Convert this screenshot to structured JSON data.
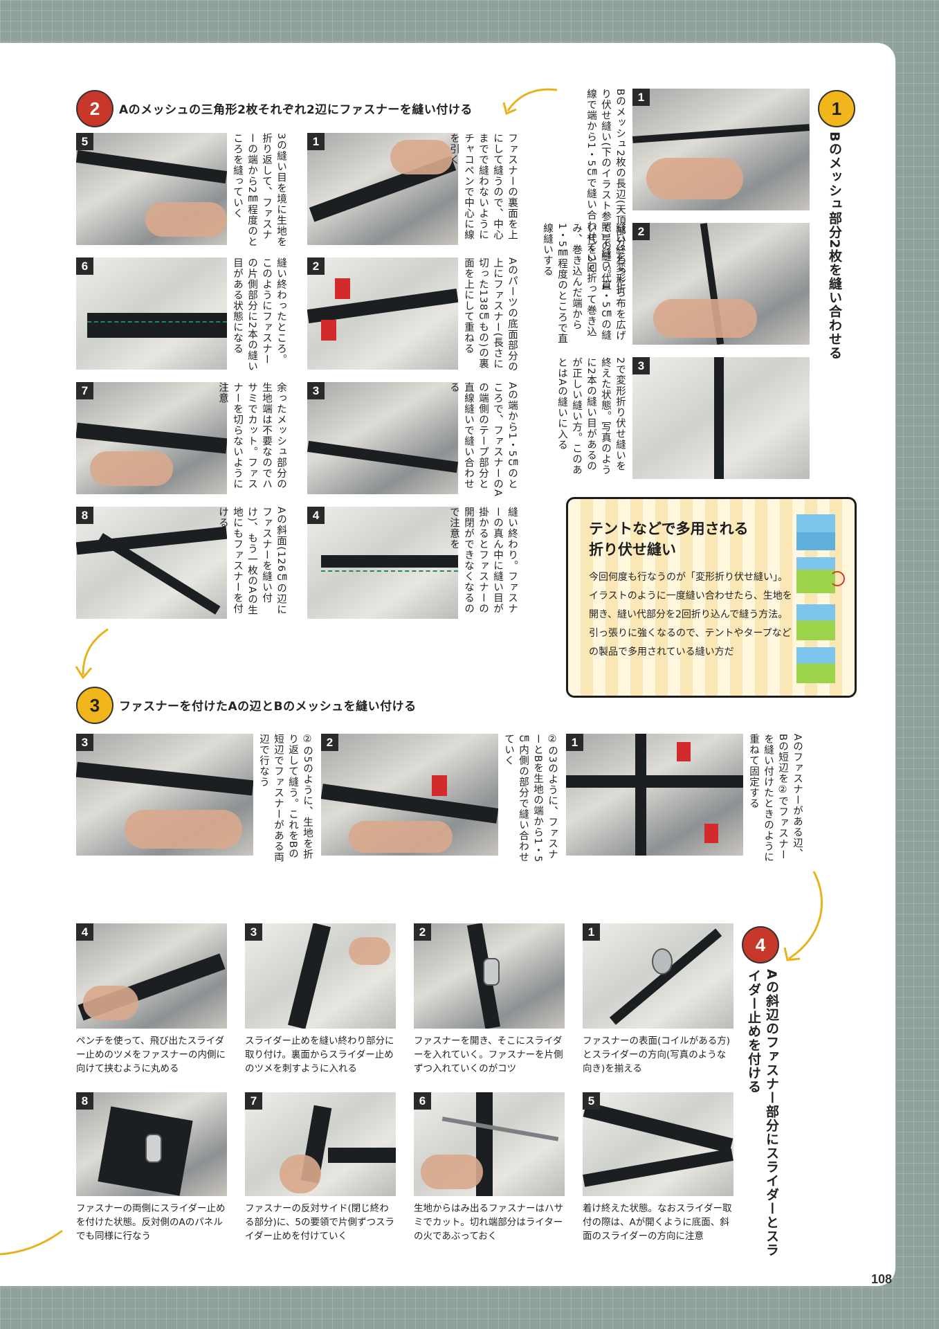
{
  "page_number": "108",
  "sections": {
    "s1": {
      "badge": "1",
      "title": "Bのメッシュ部分2枚を縫い合わせる",
      "steps": [
        {
          "num": "1",
          "text": "Bのメッシュ2枚の長辺(天頂部分)を変形折り伏せ縫い(下のイラスト参照)で縫う。直線で端から1・5㎝で縫い合わせていく"
        },
        {
          "num": "2",
          "text": "縫い終わったら布を広げて1の縫い代1・5㎝の縫い代を2回折って巻き込み、巻き込んだ端から1・5㎜程度のところで直線縫いする"
        },
        {
          "num": "3",
          "text": "2で変形折り伏せ縫いを終えた状態。写真のように2本の縫い目があるのが正しい縫い方。このあとはAの縫いに入る"
        }
      ]
    },
    "s2": {
      "badge": "2",
      "title": "Aのメッシュの三角形2枚それぞれ2辺にファスナーを縫い付ける",
      "steps": [
        {
          "num": "1",
          "text": "ファスナーの裏面を上にして縫うので、中心までで縫わないようにチャコペンで中心に線を引く"
        },
        {
          "num": "2",
          "text": "Aのパーツの底面部分の上にファスナー(長さに切った138㎝もの)の裏面を上にして重ねる"
        },
        {
          "num": "3",
          "text": "Aの端から1・5㎝のところで、ファスナーのAの端側のテープ部分と直線縫いで縫い合わせる"
        },
        {
          "num": "4",
          "text": "縫い終わり。ファスナーの真ん中に縫い目が掛かるとファスナーの開閉ができなくなるので注意を"
        },
        {
          "num": "5",
          "text": "3の縫い目を境に生地を折り返して、ファスナーの端から2㎜程度のところを縫っていく"
        },
        {
          "num": "6",
          "text": "縫い終わったところ。このようにファスナーの片側部分に2本の縫い目がある状態になる"
        },
        {
          "num": "7",
          "text": "余ったメッシュ部分の生地端は不要なのでハサミでカット。ファスナーを切らないように注意"
        },
        {
          "num": "8",
          "text": "Aの斜面(126㎝の辺にファスナーを縫い付け)、もう一枚のAの生地にもファスナーを付ける"
        }
      ]
    },
    "info_box": {
      "title_line1": "テントなどで多用される",
      "title_line2": "折り伏せ縫い",
      "text": "今回何度も行なうのが「変形折り伏せ縫い」。イラストのように一度縫い合わせたら、生地を開き、縫い代部分を2回折り込んで縫う方法。引っ張りに強くなるので、テントやタープなどの製品で多用されている縫い方だ"
    },
    "s3": {
      "badge": "3",
      "title": "ファスナーを付けたAの辺とBのメッシュを縫い付ける",
      "steps": [
        {
          "num": "1",
          "text": "Aのファスナーがある辺、Bの短辺を②でファスナーを縫い付けたときのように重ねて固定する"
        },
        {
          "num": "2",
          "text": "②の3のように、ファスナーとBを生地の端から1・5㎝内側の部分で縫い合わせていく"
        },
        {
          "num": "3",
          "text": "②の5のように、生地を折り返して縫う。これをBの短辺でファスナーがある両辺で行なう"
        }
      ]
    },
    "s4": {
      "badge": "4",
      "title": "Aの斜辺のファスナー部分にスライダーとスライダー止めを付ける",
      "steps": [
        {
          "num": "1",
          "text": "ファスナーの表面(コイルがある方)とスライダーの方向(写真のような向き)を揃える"
        },
        {
          "num": "2",
          "text": "ファスナーを開き、そこにスライダーを入れていく。ファスナーを片側ずつ入れていくのがコツ"
        },
        {
          "num": "3",
          "text": "スライダー止めを縫い終わり部分に取り付け。裏面からスライダー止めのツメを刺すように入れる"
        },
        {
          "num": "4",
          "text": "ペンチを使って、飛び出たスライダー止めのツメをファスナーの内側に向けて挟むように丸める"
        },
        {
          "num": "5",
          "text": "着け終えた状態。なおスライダー取付の際は、Aが開くように底面、斜面のスライダーの方向に注意"
        },
        {
          "num": "6",
          "text": "生地からはみ出るファスナーはハサミでカット。切れ端部分はライターの火であぶっておく"
        },
        {
          "num": "7",
          "text": "ファスナーの反対サイド(閉じ終わる部分)に、5の要領で片側ずつスライダー止めを付けていく"
        },
        {
          "num": "8",
          "text": "ファスナーの両側にスライダー止めを付けた状態。反対側のAのパネルでも同様に行なう"
        }
      ]
    }
  },
  "colors": {
    "background": "#8fa39a",
    "red_badge": "#c8382a",
    "yellow_badge": "#f0b61b",
    "arrow": "#e8b21c",
    "stitch": "#1f8a5a"
  }
}
